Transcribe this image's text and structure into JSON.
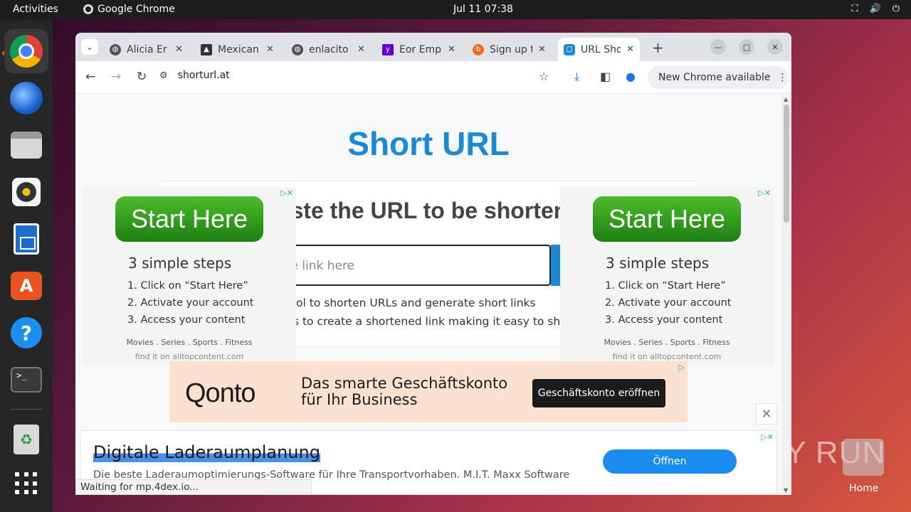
{
  "topbar": {
    "activities": "Activities",
    "app_name": "Google Chrome",
    "clock": "Jul 11  07:38"
  },
  "dock": {
    "terminal_glyph": ">_"
  },
  "tabs": [
    {
      "title": "Alicia Er",
      "close": "✕"
    },
    {
      "title": "Mexican",
      "close": "✕"
    },
    {
      "title": "enlacito",
      "close": "✕"
    },
    {
      "title": "Eor Emp",
      "close": "✕"
    },
    {
      "title": "Sign up t",
      "close": "✕"
    },
    {
      "title": "URL Sho",
      "close": "✕"
    }
  ],
  "toolbar": {
    "url": "shorturl.at",
    "new_chrome": "New Chrome available"
  },
  "page": {
    "title": "Short URL",
    "heading": "Paste the URL to be shortened",
    "input_placeholder": "Enter the link here",
    "desc_line1": "ShortURL is a free tool to shorten URLs and generate short links",
    "desc_line2": "URL shortener allows to create a shortened link making it easy to share"
  },
  "side_ad": {
    "button": "Start Here",
    "heading": "3 simple steps",
    "step1": "1. Click on “Start Here”",
    "step2": "2. Activate your account",
    "step3": "3. Access your content",
    "categories": "Movies  .  Series  .  Sports  .  Fitness",
    "footer": "find it on alltopcontent.com",
    "corner": "▷✕"
  },
  "qonto_ad": {
    "logo": "Qonto",
    "line1": "Das smarte Geschäftskonto",
    "line2": "für Ihr Business",
    "button": "Geschäftskonto eröffnen"
  },
  "bottom_ad": {
    "title": "Digitale Laderaumplanung",
    "subtitle": "Die beste Laderaumoptimierungs-Software für Ihre Transportvorhaben. M.I.T. Maxx Software",
    "button": "Öffnen",
    "close": "✕"
  },
  "status": "Waiting for mp.4dex.io...",
  "watermark": "ANY RUN",
  "desktop": {
    "home_label": "Home"
  },
  "colors": {
    "accent": "#1a8ad6",
    "ubuntu_orange": "#e95420"
  }
}
